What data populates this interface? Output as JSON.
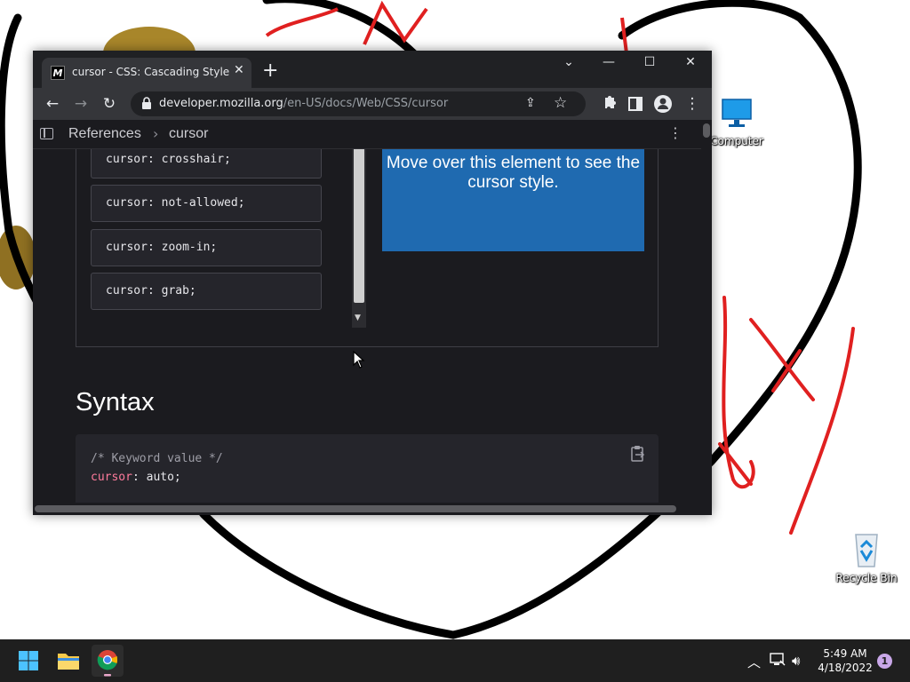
{
  "browser": {
    "tab_title": "cursor - CSS: Cascading Style Sheets | MDN",
    "favicon_letter": "M",
    "url_host": "developer.mozilla.org",
    "url_path": "/en-US/docs/Web/CSS/cursor"
  },
  "page": {
    "breadcrumb": [
      "References",
      "cursor"
    ],
    "cursor_choices": [
      "cursor: crosshair;",
      "cursor: not-allowed;",
      "cursor: zoom-in;",
      "cursor: grab;"
    ],
    "preview_text": "Move over this element to see the cursor style.",
    "section_heading": "Syntax",
    "code_comment": "/* Keyword value */",
    "code_property": "cursor",
    "code_value": ": auto;"
  },
  "desktop": {
    "icons": [
      {
        "label": "Computer",
        "icon": "monitor-icon"
      },
      {
        "label": "Recycle Bin",
        "icon": "recycle-bin-icon"
      }
    ]
  },
  "taskbar": {
    "apps": [
      "start-icon",
      "file-explorer-icon",
      "chrome-icon"
    ],
    "time": "5:49 AM",
    "date": "4/18/2022",
    "notification_count": "1"
  },
  "colors": {
    "page_bg": "#1b1b1f",
    "preview_bg": "#1f6ab0",
    "code_property": "#ff7b9c",
    "taskbar_bg": "#1f1f1f"
  }
}
